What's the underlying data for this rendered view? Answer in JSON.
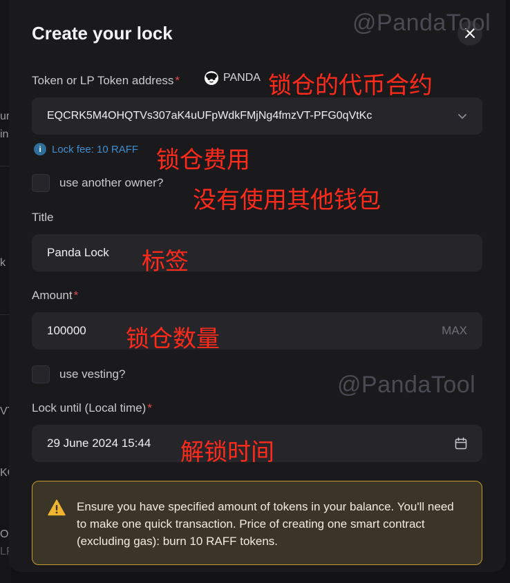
{
  "background": {
    "fragments": [
      "ur",
      "in",
      "k",
      "VT",
      "KO",
      "O",
      "LF"
    ]
  },
  "modal": {
    "title": "Create your lock",
    "close_icon": "close-icon"
  },
  "token_address": {
    "label": "Token or LP Token address",
    "required_mark": "*",
    "token_symbol": "PANDA",
    "value": "EQCRK5M4OHQTVs307aK4uUFpWdkFMjNg4fmzVT-PFG0qVtKc",
    "dropdown_icon": "chevron-down-icon"
  },
  "fee": {
    "icon": "info-icon",
    "text": "Lock fee: 10 RAFF"
  },
  "another_owner": {
    "label": "use another owner?",
    "checked": false
  },
  "title_field": {
    "label": "Title",
    "value": "Panda Lock"
  },
  "amount": {
    "label": "Amount",
    "required_mark": "*",
    "value": "100000",
    "max_label": "MAX"
  },
  "vesting": {
    "label": "use vesting?",
    "checked": false
  },
  "lock_until": {
    "label": "Lock until (Local time)",
    "required_mark": "*",
    "value": "29 June 2024 15:44",
    "calendar_icon": "calendar-icon"
  },
  "warning": {
    "icon": "warning-icon",
    "text": "Ensure you have specified amount of tokens in your balance. You'll need to make one quick transaction. Price of creating one smart contract (excluding gas): burn 10 RAFF tokens."
  },
  "watermarks": [
    "@PandaTool",
    "@PandaTool"
  ],
  "annotations": {
    "token_contract": "锁仓的代币合约",
    "lock_fee": "锁仓费用",
    "no_other_wallet": "没有使用其他钱包",
    "title_tag": "标签",
    "lock_amount": "锁仓数量",
    "unlock_time": "解锁时间"
  },
  "colors": {
    "accent_info": "#3b8fd1",
    "required": "#e5484d",
    "warning_border": "#c59d2a",
    "annotation": "#ff2a1a"
  }
}
